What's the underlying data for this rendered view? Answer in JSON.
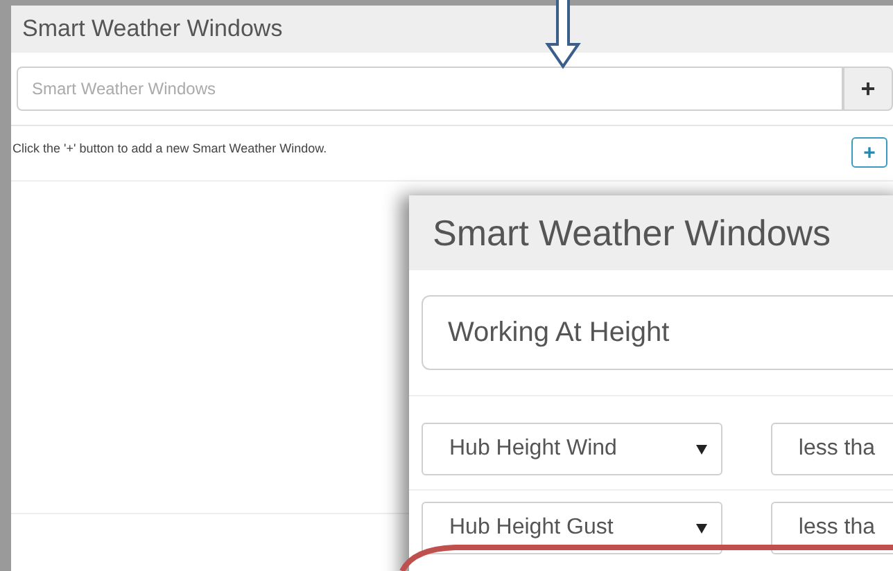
{
  "panel": {
    "title": "Smart Weather Windows",
    "name_field": {
      "placeholder": "Smart Weather Windows"
    },
    "add_button": "+",
    "hint": "Click the '+' button to add a new Smart Weather Window.",
    "add_window_button": "+"
  },
  "zoomed_panel": {
    "title": "Smart Weather Windows",
    "name_field": {
      "value": "Working At Height"
    },
    "conditions": [
      {
        "parameter": "Hub Height Wind",
        "operator": "less tha"
      },
      {
        "parameter": "Hub Height Gust",
        "operator": "less tha"
      }
    ]
  }
}
